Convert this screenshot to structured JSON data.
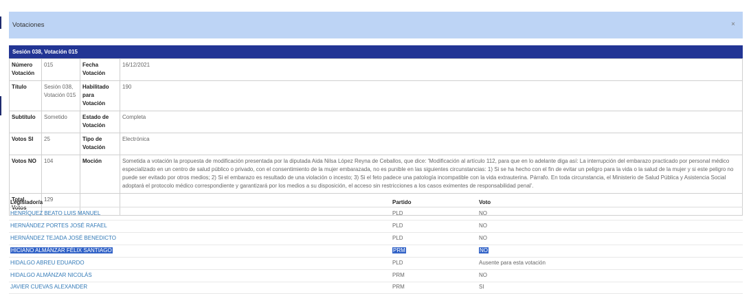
{
  "modal": {
    "title": "Votaciones",
    "close_glyph": "×"
  },
  "section": {
    "title": "Sesión 038, Votación 015"
  },
  "info": {
    "numero_label": "Número Votación",
    "numero_value": "015",
    "fecha_label": "Fecha Votación",
    "fecha_value": "16/12/2021",
    "titulo_label": "Título",
    "titulo_value": "Sesión 038, Votación 015",
    "habilitado_label": "Habilitado para Votación",
    "habilitado_value": "190",
    "subtitulo_label": "Subtítulo",
    "subtitulo_value": "Sometido",
    "estado_label": "Estado de Votación",
    "estado_value": "Completa",
    "votos_si_label": "Votos SI",
    "votos_si_value": "25",
    "tipo_label": "Tipo de Votación",
    "tipo_value": "Electrónica",
    "votos_no_label": "Votos NO",
    "votos_no_value": "104",
    "mocion_label": "Moción",
    "mocion_value": "Sometida a votación la propuesta de modificación presentada por la diputada Aida Nilsa López Reyna de Ceballos, que dice: 'Modificación al artículo 112, para que en lo adelante diga así: La interrupción del embarazo practicado por personal médico especializado en un centro de salud público o privado, con el consentimiento de la mujer embarazada, no es punible en las siguientes circunstancias: 1) Si se ha hecho con el fin de evitar un peligro para la vida o la salud de la mujer y si este peligro no puede ser evitado por otros medios; 2) Si el embarazo es resultado de una violación o incesto; 3) Si el feto padece una patología incompatible con la vida extrauterina. Párrafo. En toda circunstancia, el Ministerio de Salud Pública y Asistencia Social adoptará el protocolo médico correspondiente y garantizará por los medios a su disposición, el acceso sin restricciones a los casos eximentes de responsabilidad penal'.",
    "total_label": "Total Votos",
    "total_value": "129"
  },
  "votes": {
    "headers": {
      "legislador": "Legislador/a",
      "partido": "Partido",
      "voto": "Voto"
    },
    "rows": [
      {
        "name": "HENRÍQUEZ BEATO LUIS MANUEL",
        "party": "PLD",
        "vote": "NO"
      },
      {
        "name": "HERNÁNDEZ PORTES JOSÉ RAFAEL",
        "party": "PLD",
        "vote": "NO"
      },
      {
        "name": "HERNÁNDEZ TEJADA JOSÉ BENEDICTO",
        "party": "PLD",
        "vote": "NO"
      },
      {
        "name": "HICIANO ALMÁNZAR FÉLIX SANTIAGO",
        "party": "PRM",
        "vote": "NO"
      },
      {
        "name": "HIDALGO ABREU EDUARDO",
        "party": "PLD",
        "vote": "Ausente para esta votación"
      },
      {
        "name": "HIDALGO ALMÁNZAR NICOLÁS",
        "party": "PRM",
        "vote": "NO"
      },
      {
        "name": "JAVIER CUEVAS ALEXANDER",
        "party": "PRM",
        "vote": "SI"
      }
    ]
  },
  "colors": {
    "header_bg": "#bdd4f5",
    "section_bg": "#223594",
    "link": "#337ab7",
    "selection": "#3162c7"
  }
}
